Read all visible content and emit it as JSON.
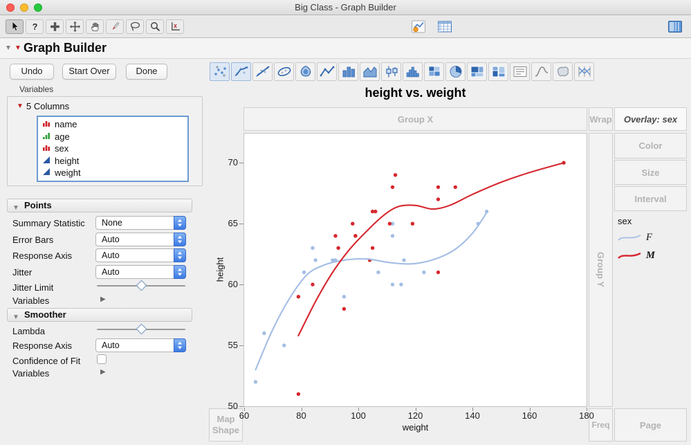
{
  "window": {
    "title": "Big Class - Graph Builder"
  },
  "toolbar": {
    "tools": [
      {
        "name": "arrow-tool",
        "selected": true
      },
      {
        "name": "help-tool",
        "selected": false
      },
      {
        "name": "selection-tool",
        "selected": false
      },
      {
        "name": "move-tool",
        "selected": false
      },
      {
        "name": "grabber-tool",
        "selected": false
      },
      {
        "name": "brush-tool",
        "selected": false
      },
      {
        "name": "lasso-tool",
        "selected": false
      },
      {
        "name": "magnifier-tool",
        "selected": false
      },
      {
        "name": "axis-tool",
        "selected": false
      }
    ],
    "center_icons": [
      {
        "name": "graph-builder-icon"
      },
      {
        "name": "data-table-icon"
      }
    ],
    "right_icons": [
      {
        "name": "panel-toggle-icon"
      }
    ]
  },
  "outline": {
    "title": "Graph Builder"
  },
  "actions": {
    "undo": "Undo",
    "start_over": "Start Over",
    "done": "Done"
  },
  "palette": {
    "items": [
      {
        "name": "points",
        "active": true
      },
      {
        "name": "smoother",
        "active": true
      },
      {
        "name": "line-of-fit",
        "active": false
      },
      {
        "name": "ellipse",
        "active": false
      },
      {
        "name": "contour",
        "active": false
      },
      {
        "name": "line",
        "active": false
      },
      {
        "name": "bar",
        "active": false
      },
      {
        "name": "area",
        "active": false
      },
      {
        "name": "box-plot",
        "active": false
      },
      {
        "name": "histogram",
        "active": false
      },
      {
        "name": "heatmap",
        "active": false
      },
      {
        "name": "pie",
        "active": false
      },
      {
        "name": "treemap",
        "active": false
      },
      {
        "name": "mosaic",
        "active": false
      },
      {
        "name": "caption-box",
        "active": false
      },
      {
        "name": "formula",
        "active": false
      },
      {
        "name": "map-shapes",
        "active": false
      },
      {
        "name": "parallel-plot",
        "active": false
      }
    ]
  },
  "variables_panel": {
    "section_label": "Variables",
    "columns_header": "5 Columns",
    "columns": [
      {
        "label": "name",
        "type": "nominal"
      },
      {
        "label": "age",
        "type": "ordinal"
      },
      {
        "label": "sex",
        "type": "nominal"
      },
      {
        "label": "height",
        "type": "continuous"
      },
      {
        "label": "weight",
        "type": "continuous"
      }
    ]
  },
  "points_panel": {
    "title": "Points",
    "summary_statistic": {
      "label": "Summary Statistic",
      "value": "None"
    },
    "error_bars": {
      "label": "Error Bars",
      "value": "Auto"
    },
    "response_axis": {
      "label": "Response Axis",
      "value": "Auto"
    },
    "jitter": {
      "label": "Jitter",
      "value": "Auto"
    },
    "jitter_limit": {
      "label": "Jitter Limit",
      "slider_pos": 0.5
    },
    "variables": {
      "label": "Variables"
    }
  },
  "smoother_panel": {
    "title": "Smoother",
    "lambda": {
      "label": "Lambda",
      "slider_pos": 0.5
    },
    "response_axis": {
      "label": "Response Axis",
      "value": "Auto"
    },
    "confidence": {
      "label": "Confidence of Fit",
      "checked": false
    },
    "variables": {
      "label": "Variables"
    }
  },
  "graph": {
    "zones": {
      "group_x": "Group X",
      "wrap": "Wrap",
      "overlay": "Overlay: sex",
      "color": "Color",
      "size": "Size",
      "interval": "Interval",
      "group_y": "Group Y",
      "freq": "Freq",
      "page": "Page",
      "map_shape": "Map Shape"
    },
    "legend": {
      "title": "sex",
      "items": [
        {
          "label": "F",
          "color": "#a3bde4",
          "bold": false
        },
        {
          "label": "M",
          "color": "#d6272e",
          "bold": true
        }
      ]
    }
  },
  "chart_data": {
    "type": "scatter",
    "title": "height vs. weight",
    "xlabel": "weight",
    "ylabel": "height",
    "xlim": [
      60,
      180
    ],
    "ylim": [
      50,
      72.4
    ],
    "xticks": [
      60,
      80,
      100,
      120,
      140,
      160,
      180
    ],
    "yticks": [
      50,
      55,
      60,
      65,
      70
    ],
    "grid": false,
    "legend_position": "right",
    "series": [
      {
        "name": "F",
        "color": "#a3bde4",
        "points": [
          [
            95,
            59
          ],
          [
            123,
            61
          ],
          [
            74,
            55
          ],
          [
            145,
            66
          ],
          [
            64,
            52
          ],
          [
            112,
            60
          ],
          [
            107,
            61
          ],
          [
            67,
            56
          ],
          [
            81,
            61
          ],
          [
            91,
            62
          ],
          [
            142,
            65
          ],
          [
            84,
            63
          ],
          [
            85,
            62
          ],
          [
            92,
            62
          ],
          [
            112,
            64
          ],
          [
            112,
            65
          ],
          [
            115,
            60
          ],
          [
            116,
            62
          ]
        ]
      },
      {
        "name": "M",
        "color": "#d6272e",
        "points": [
          [
            84,
            60
          ],
          [
            128,
            61
          ],
          [
            79,
            51
          ],
          [
            98,
            65
          ],
          [
            105,
            63
          ],
          [
            95,
            58
          ],
          [
            79,
            59
          ],
          [
            93,
            63
          ],
          [
            99,
            64
          ],
          [
            119,
            65
          ],
          [
            92,
            64
          ],
          [
            112,
            68
          ],
          [
            99,
            64
          ],
          [
            113,
            69
          ],
          [
            128,
            67
          ],
          [
            111,
            65
          ],
          [
            105,
            66
          ],
          [
            104,
            62
          ],
          [
            106,
            66
          ],
          [
            128,
            68
          ],
          [
            134,
            68
          ],
          [
            172,
            70
          ]
        ]
      }
    ],
    "smoothers": [
      {
        "name": "F",
        "color": "#a3bde4",
        "curve": [
          [
            64,
            53
          ],
          [
            70,
            56.3
          ],
          [
            76,
            58.9
          ],
          [
            82,
            60.8
          ],
          [
            88,
            61.6
          ],
          [
            95,
            62
          ],
          [
            103,
            62.1
          ],
          [
            111,
            61.8
          ],
          [
            119,
            61.7
          ],
          [
            127,
            62.1
          ],
          [
            134,
            62.9
          ],
          [
            140,
            64.2
          ],
          [
            145,
            65.9
          ]
        ]
      },
      {
        "name": "M",
        "color": "#d6272e",
        "curve": [
          [
            79,
            55.8
          ],
          [
            85,
            58.6
          ],
          [
            91,
            61
          ],
          [
            97,
            62.9
          ],
          [
            103,
            64.4
          ],
          [
            109,
            65.7
          ],
          [
            114,
            66.4
          ],
          [
            120,
            66.5
          ],
          [
            126,
            66.2
          ],
          [
            132,
            66.5
          ],
          [
            140,
            67.4
          ],
          [
            150,
            68.4
          ],
          [
            160,
            69.2
          ],
          [
            172,
            70
          ]
        ]
      }
    ]
  }
}
